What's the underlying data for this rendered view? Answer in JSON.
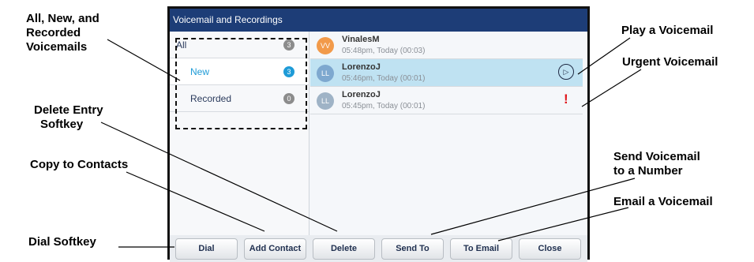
{
  "callouts": {
    "all_new_recorded": [
      "All, New, and",
      "Recorded",
      "Voicemails"
    ],
    "play_voicemail": "Play a Voicemail",
    "urgent_voicemail": "Urgent Voicemail",
    "delete_entry": [
      "Delete Entry",
      "Softkey"
    ],
    "copy_to_contacts": "Copy to Contacts",
    "send_voicemail": [
      "Send Voicemail",
      "to a Number"
    ],
    "email_voicemail": "Email a Voicemail",
    "dial_softkey": "Dial Softkey"
  },
  "screen": {
    "title": "Voicemail and Recordings",
    "filters": [
      {
        "label": "All",
        "count": "3",
        "count_color": "#8c8c8c",
        "label_color": "#2a3a5c"
      },
      {
        "label": "New",
        "count": "3",
        "count_color": "#1e9bd7",
        "label_color": "#1e9bd7"
      },
      {
        "label": "Recorded",
        "count": "0",
        "count_color": "#8c8c8c",
        "label_color": "#2a3a5c"
      }
    ],
    "voicemails": [
      {
        "initials": "VV",
        "name": "VinalesM",
        "time": "05:48pm, Today (00:03)",
        "avatar_color": "#f29a4a",
        "selected": false
      },
      {
        "initials": "LL",
        "name": "LorenzoJ",
        "time": "05:46pm, Today (00:01)",
        "avatar_color": "#7ea8cf",
        "selected": true
      },
      {
        "initials": "LL",
        "name": "LorenzoJ",
        "time": "05:45pm, Today (00:01)",
        "avatar_color": "#9fb3c6",
        "selected": false
      }
    ],
    "urgent_mark": "!",
    "play_icon": "▷",
    "softkeys": [
      "Dial",
      "Add Contact",
      "Delete",
      "Send To",
      "To Email",
      "Close"
    ]
  },
  "colors": {
    "titlebar": "#1d3d77",
    "selected_row": "#bfe2f2",
    "urgent": "#e0161b"
  }
}
